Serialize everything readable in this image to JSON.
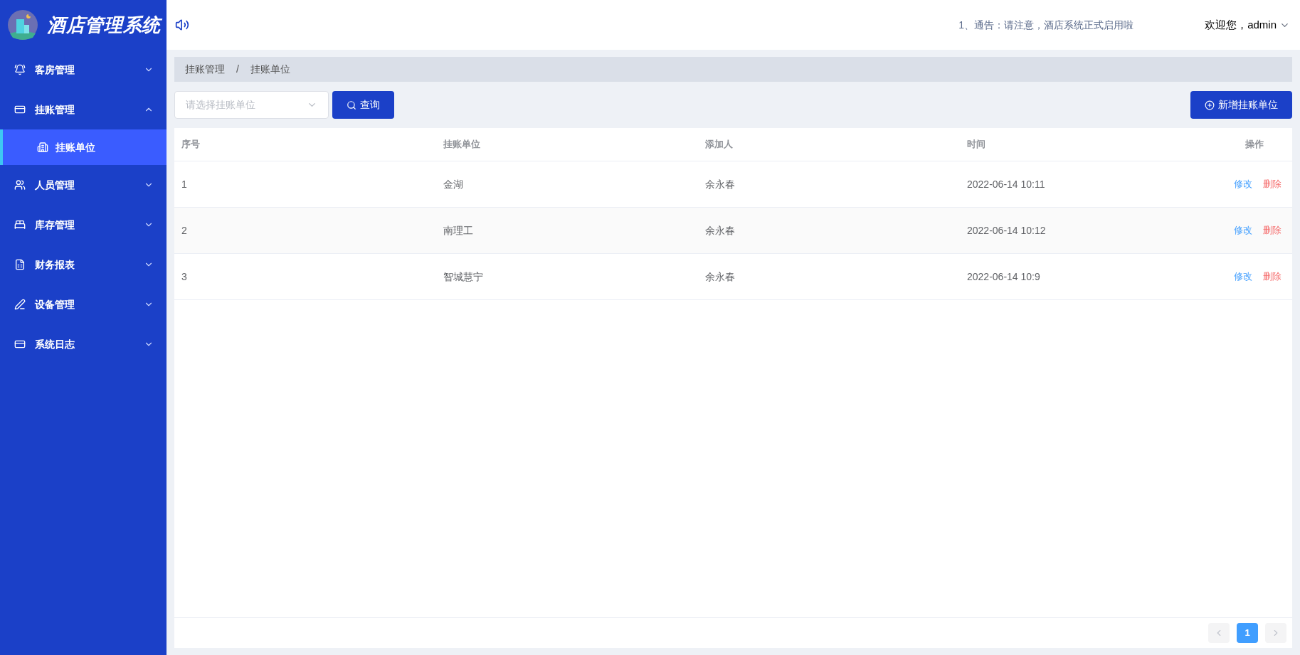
{
  "app": {
    "title": "酒店管理系统"
  },
  "sidebar": {
    "items": [
      {
        "label": "客房管理",
        "expanded": false
      },
      {
        "label": "挂账管理",
        "expanded": true,
        "children": [
          {
            "label": "挂账单位",
            "selected": true
          }
        ]
      },
      {
        "label": "人员管理",
        "expanded": false
      },
      {
        "label": "库存管理",
        "expanded": false
      },
      {
        "label": "财务报表",
        "expanded": false
      },
      {
        "label": "设备管理",
        "expanded": false
      },
      {
        "label": "系统日志",
        "expanded": false
      }
    ]
  },
  "header": {
    "notice": "1、通告：请注意，酒店系统正式启用啦",
    "user": "欢迎您，admin"
  },
  "breadcrumb": [
    "挂账管理",
    "挂账单位"
  ],
  "breadcrumb_separator": "/",
  "toolbar": {
    "select": {
      "placeholder": "请选择挂账单位"
    },
    "search_button": "查询",
    "add_button": "新增挂账单位"
  },
  "table": {
    "columns": [
      "序号",
      "挂账单位",
      "添加人",
      "时间",
      "操作"
    ],
    "rows": [
      {
        "cells": [
          "1",
          "金湖",
          "余永春",
          "2022-06-14 10:11"
        ],
        "actions": [
          "修改",
          "删除"
        ]
      },
      {
        "cells": [
          "2",
          "南理工",
          "余永春",
          "2022-06-14 10:12"
        ],
        "actions": [
          "修改",
          "删除"
        ]
      },
      {
        "cells": [
          "3",
          "智城慧宁",
          "余永春",
          "2022-06-14 10:9"
        ],
        "actions": [
          "修改",
          "删除"
        ]
      }
    ]
  },
  "pagination": {
    "pages": [
      {
        "label": "1",
        "selected": true
      }
    ]
  }
}
